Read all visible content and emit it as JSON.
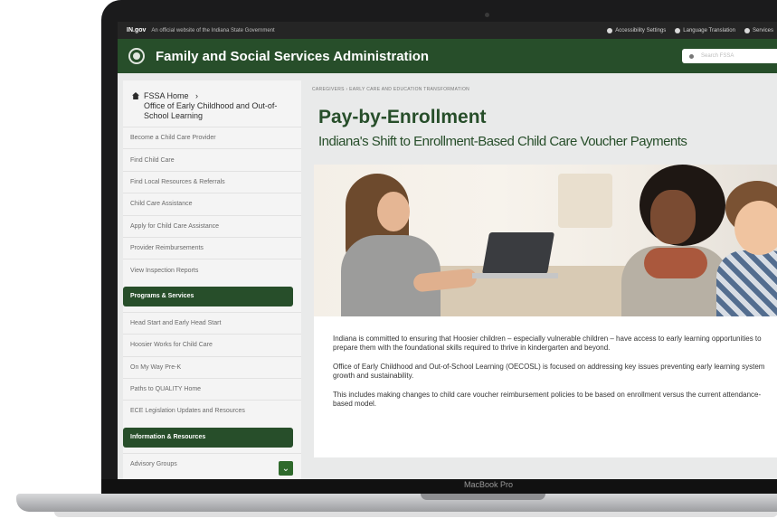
{
  "device": {
    "label": "MacBook Pro"
  },
  "gov_bar": {
    "logo": "IN.gov",
    "tagline": "An official website of the Indiana State Government",
    "links": [
      "Accessibility Settings",
      "Language Translation",
      "Services"
    ]
  },
  "agency": {
    "title": "Family and Social Services Administration",
    "search_placeholder": "Search FSSA"
  },
  "sidebar": {
    "home_label": "FSSA Home",
    "home_sub": "Office of Early Childhood and Out-of-School Learning",
    "items": [
      "Become a Child Care Provider",
      "Find Child Care",
      "Find Local Resources & Referrals",
      "Child Care Assistance",
      "Apply for Child Care Assistance",
      "Provider Reimbursements",
      "View Inspection Reports"
    ],
    "section_programs": "Programs & Services",
    "program_items": [
      "Head Start and Early Head Start",
      "Hoosier Works for Child Care",
      "On My Way Pre-K",
      "Paths to QUALITY Home",
      "ECE Legislation Updates and Resources"
    ],
    "section_info": "Information & Resources",
    "info_items": [
      "Advisory Groups"
    ]
  },
  "main": {
    "breadcrumb": "CAREGIVERS  ›  EARLY CARE AND EDUCATION TRANSFORMATION",
    "title": "Pay-by-Enrollment",
    "subtitle": "Indiana's Shift to Enrollment-Based Child Care Voucher Payments",
    "paragraphs": [
      "Indiana is committed to ensuring that Hoosier children – especially vulnerable children – have access to early learning opportunities to prepare them with the foundational skills required to thrive in kindergarten and beyond.",
      "Office of Early Childhood and Out-of-School Learning (OECOSL) is focused on addressing key issues preventing early learning system growth and sustainability.",
      "This includes making changes to child care voucher reimbursement policies to be based on enrollment versus the current attendance-based model."
    ]
  }
}
